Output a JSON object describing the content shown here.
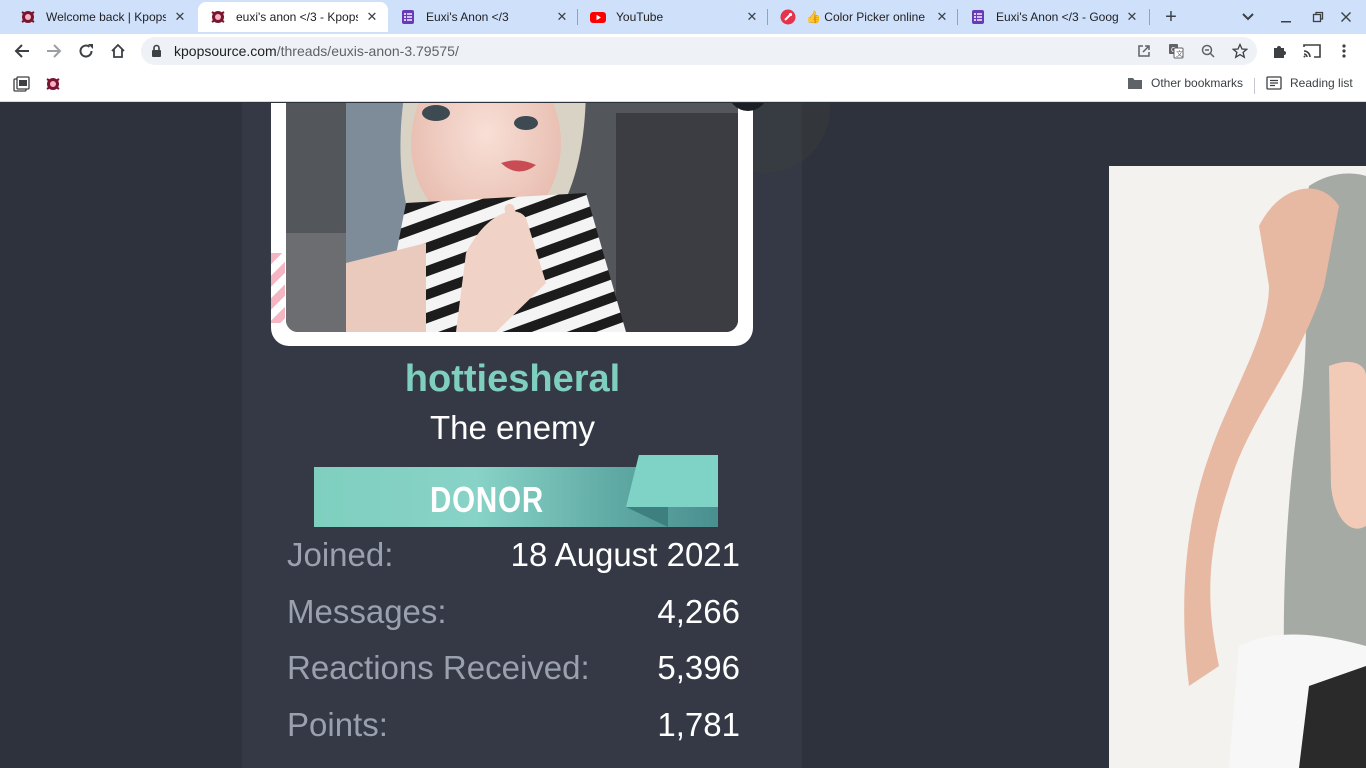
{
  "browser": {
    "tabs": [
      {
        "title": "Welcome back | Kpops",
        "icon": "kpopsource-favicon-icon",
        "active": false
      },
      {
        "title": "euxi's anon </3 - Kpops",
        "icon": "kpopsource-favicon-icon",
        "active": true
      },
      {
        "title": "Euxi's Anon </3",
        "icon": "google-forms-icon",
        "active": false
      },
      {
        "title": "YouTube",
        "icon": "youtube-icon",
        "active": false
      },
      {
        "title": "👍 Color Picker online |",
        "icon": "color-picker-icon",
        "active": false
      },
      {
        "title": "Euxi's Anon </3 - Googl",
        "icon": "google-forms-icon",
        "active": false
      }
    ],
    "url": {
      "domain": "kpopsource.com",
      "path": "/threads/euxis-anon-3.79575/"
    },
    "bookmarks": {
      "other_bookmarks": "Other bookmarks",
      "reading_list": "Reading list"
    }
  },
  "profile": {
    "username": "hottiesheral",
    "user_title": "The enemy",
    "banner": "DONOR",
    "stats": [
      {
        "label": "Joined:",
        "value": "18 August 2021"
      },
      {
        "label": "Messages:",
        "value": "4,266"
      },
      {
        "label": "Reactions Received:",
        "value": "5,396"
      },
      {
        "label": "Points:",
        "value": "1,781"
      }
    ]
  },
  "colors": {
    "page_background": "#2e323d",
    "panel_background": "#343945",
    "username": "#7fcfbf",
    "stat_label": "#9aa0ae",
    "online_indicator": "#7fb52a",
    "tab_strip": "#cfe0fb"
  }
}
